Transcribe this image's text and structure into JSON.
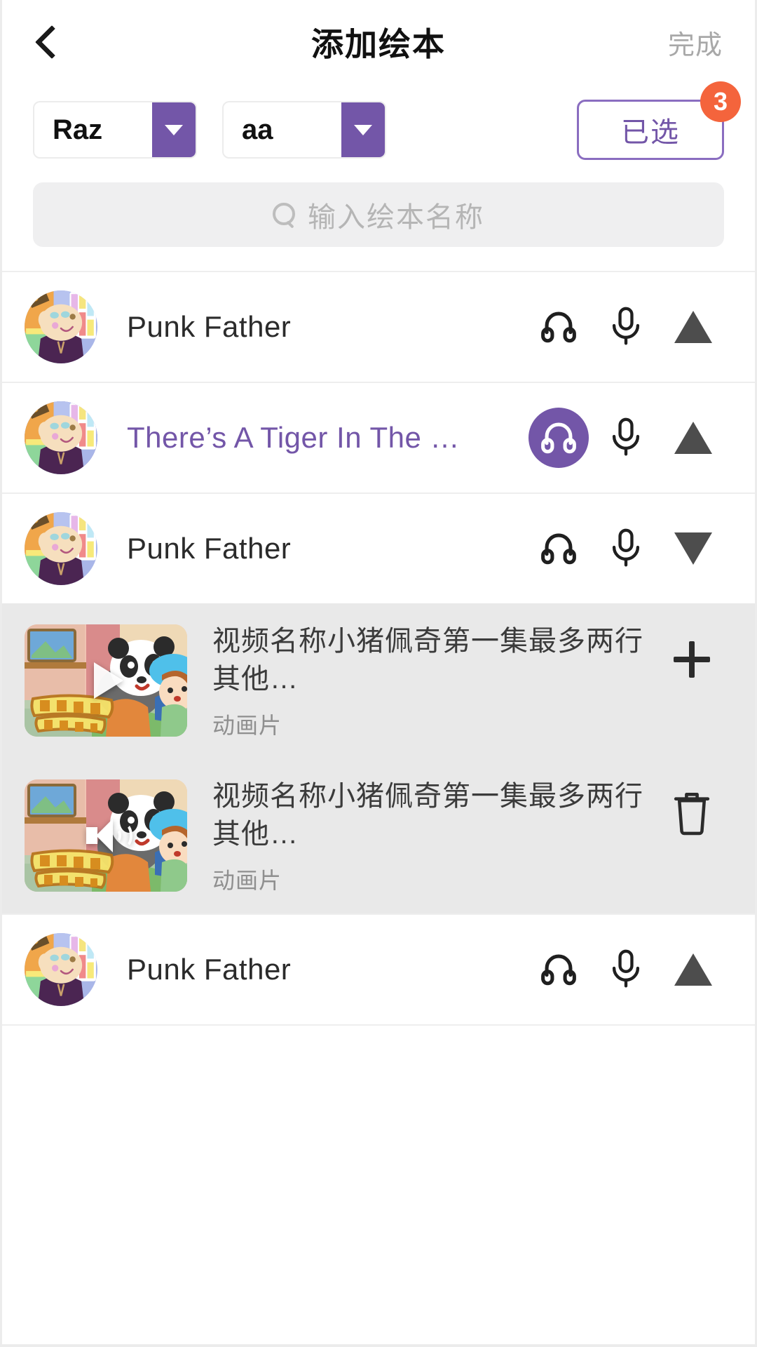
{
  "nav": {
    "back_icon": "chevron-left-icon",
    "title": "添加绘本",
    "done_label": "完成"
  },
  "filters": {
    "series_dropdown": {
      "value": "Raz",
      "arrow_icon": "caret-down-icon"
    },
    "level_dropdown": {
      "value": "aa",
      "arrow_icon": "caret-down-icon"
    },
    "selected_button": {
      "label": "已选",
      "badge_count": "3"
    }
  },
  "search": {
    "icon": "search-icon",
    "placeholder": "输入绘本名称"
  },
  "colors": {
    "purple": "#7356a8",
    "purple_border": "#8a6dc0",
    "badge_orange": "#f4643c",
    "group_bg": "#e9e9e9",
    "search_bg": "#efeff0"
  },
  "list": [
    {
      "kind": "book",
      "title": "Punk Father",
      "active": false,
      "avatar_ring": false,
      "headphone_active": false,
      "headphone_icon": "headphone-icon",
      "mic_icon": "microphone-icon",
      "toggle_icon": "triangle-up-icon"
    },
    {
      "kind": "book",
      "title": "There’s A Tiger In The …",
      "active": true,
      "avatar_ring": true,
      "headphone_active": true,
      "headphone_icon": "headphone-icon",
      "mic_icon": "microphone-icon",
      "toggle_icon": "triangle-up-icon"
    },
    {
      "kind": "book",
      "title": "Punk Father",
      "active": false,
      "avatar_ring": false,
      "headphone_active": false,
      "headphone_icon": "headphone-icon",
      "mic_icon": "microphone-icon",
      "toggle_icon": "triangle-down-icon"
    },
    {
      "kind": "video",
      "title": "视频名称小猪佩奇第一集最多两行其他…",
      "subtitle": "动画片",
      "overlay_icon": "play-icon",
      "action_icon": "plus-icon"
    },
    {
      "kind": "video",
      "title": "视频名称小猪佩奇第一集最多两行其他…",
      "subtitle": "动画片",
      "overlay_icon": "speaker-icon",
      "action_icon": "trash-icon"
    },
    {
      "kind": "book",
      "title": "Punk Father",
      "active": false,
      "avatar_ring": false,
      "headphone_active": false,
      "headphone_icon": "headphone-icon",
      "mic_icon": "microphone-icon",
      "toggle_icon": "triangle-up-icon"
    }
  ]
}
